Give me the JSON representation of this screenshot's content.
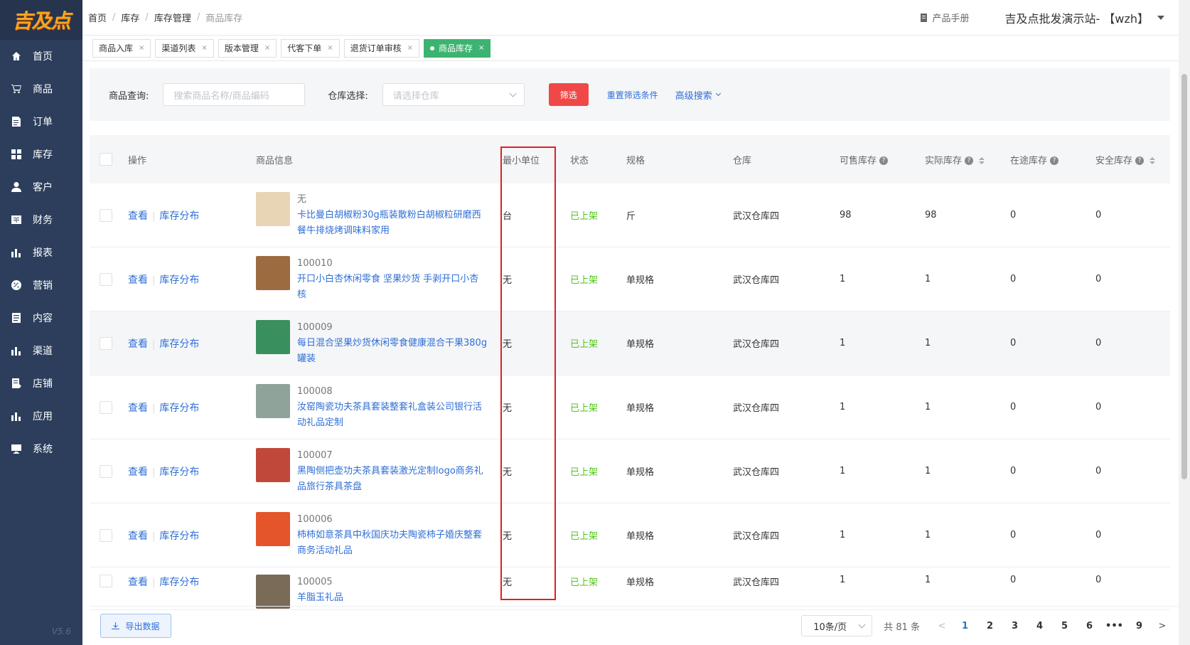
{
  "logo": {
    "text": "吉及点"
  },
  "sidebar": {
    "items": [
      {
        "label": "首页",
        "icon": "home-icon"
      },
      {
        "label": "商品",
        "icon": "cart-icon"
      },
      {
        "label": "订单",
        "icon": "order-icon"
      },
      {
        "label": "库存",
        "icon": "grid-icon"
      },
      {
        "label": "客户",
        "icon": "user-icon"
      },
      {
        "label": "财务",
        "icon": "finance-icon"
      },
      {
        "label": "报表",
        "icon": "bar-chart-icon"
      },
      {
        "label": "营销",
        "icon": "percent-icon"
      },
      {
        "label": "内容",
        "icon": "document-icon"
      },
      {
        "label": "渠道",
        "icon": "bar-chart-icon"
      },
      {
        "label": "店铺",
        "icon": "edit-doc-icon"
      },
      {
        "label": "应用",
        "icon": "bar-chart-icon"
      },
      {
        "label": "系统",
        "icon": "monitor-icon"
      }
    ],
    "version": "V5.6"
  },
  "header": {
    "breadcrumb": [
      "首页",
      "库存",
      "库存管理",
      "商品库存"
    ],
    "manual": "产品手册",
    "site": "吉及点批发演示站- 【wzh】"
  },
  "tabs": [
    {
      "label": "商品入库",
      "active": false
    },
    {
      "label": "渠道列表",
      "active": false
    },
    {
      "label": "版本管理",
      "active": false
    },
    {
      "label": "代客下单",
      "active": false
    },
    {
      "label": "退货订单审核",
      "active": false
    },
    {
      "label": "商品库存",
      "active": true
    }
  ],
  "filter": {
    "product_label": "商品查询:",
    "product_placeholder": "搜索商品名称/商品编码",
    "warehouse_label": "仓库选择:",
    "warehouse_placeholder": "请选择仓库",
    "filter_button": "筛选",
    "reset": "重置筛选条件",
    "advanced": "高级搜索"
  },
  "table": {
    "headers": {
      "op": "操作",
      "info": "商品信息",
      "unit": "最小单位",
      "status": "状态",
      "spec": "规格",
      "warehouse": "仓库",
      "sale": "可售库存",
      "real": "实际库存",
      "transit": "在途库存",
      "safe": "安全库存"
    },
    "view_label": "查看",
    "dist_label": "库存分布",
    "rows": [
      {
        "code": "无",
        "name": "卡比曼白胡椒粉30g瓶装散粉白胡椒粒研磨西餐牛排烧烤调味料家用",
        "unit": "台",
        "status": "已上架",
        "spec": "斤",
        "warehouse": "武汉仓库四",
        "sale": "98",
        "real": "98",
        "transit": "0",
        "safe": "0",
        "thumb_color": "#e8d5b5"
      },
      {
        "code": "100010",
        "name": "开口小白杏休闲零食 坚果炒货 手剥开口小杏核",
        "unit": "无",
        "status": "已上架",
        "spec": "单规格",
        "warehouse": "武汉仓库四",
        "sale": "1",
        "real": "1",
        "transit": "0",
        "safe": "0",
        "thumb_color": "#9c6b3f"
      },
      {
        "code": "100009",
        "name": "每日混合坚果炒货休闲零食健康混合干果380g罐装",
        "unit": "无",
        "status": "已上架",
        "spec": "单规格",
        "warehouse": "武汉仓库四",
        "sale": "1",
        "real": "1",
        "transit": "0",
        "safe": "0",
        "thumb_color": "#3a8f5e"
      },
      {
        "code": "100008",
        "name": "汝窑陶瓷功夫茶具套装整套礼盒装公司银行活动礼品定制",
        "unit": "无",
        "status": "已上架",
        "spec": "单规格",
        "warehouse": "武汉仓库四",
        "sale": "1",
        "real": "1",
        "transit": "0",
        "safe": "0",
        "thumb_color": "#8fa39a"
      },
      {
        "code": "100007",
        "name": "黑陶侧把壶功夫茶具套装激光定制logo商务礼品旅行茶具茶盘",
        "unit": "无",
        "status": "已上架",
        "spec": "单规格",
        "warehouse": "武汉仓库四",
        "sale": "1",
        "real": "1",
        "transit": "0",
        "safe": "0",
        "thumb_color": "#c0483a"
      },
      {
        "code": "100006",
        "name": "柿柿如意茶具中秋国庆功夫陶瓷柿子婚庆整套商务活动礼品",
        "unit": "无",
        "status": "已上架",
        "spec": "单规格",
        "warehouse": "武汉仓库四",
        "sale": "1",
        "real": "1",
        "transit": "0",
        "safe": "0",
        "thumb_color": "#e4552b"
      },
      {
        "code": "100005",
        "name": "羊脂玉礼品",
        "unit": "无",
        "status": "已上架",
        "spec": "单规格",
        "warehouse": "武汉仓库四",
        "sale": "1",
        "real": "1",
        "transit": "0",
        "safe": "0",
        "thumb_color": "#7a6a58"
      }
    ]
  },
  "footer": {
    "export": "导出数据",
    "page_size": "10条/页",
    "total": "共 81 条",
    "pages": [
      "1",
      "2",
      "3",
      "4",
      "5",
      "6",
      "•••",
      "9"
    ],
    "current_page": 1
  }
}
